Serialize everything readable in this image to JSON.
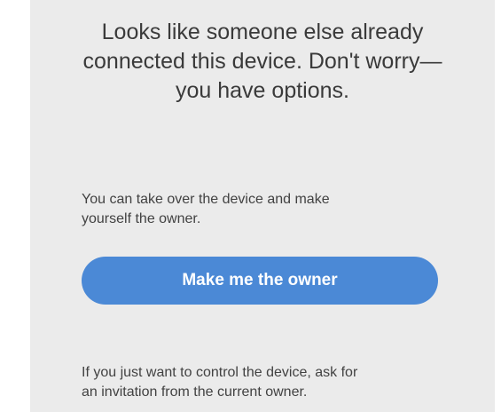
{
  "header": {
    "line_1": "Looks like someone else already",
    "line_2": "connected this device. Don't worry—",
    "line_3": "you have options."
  },
  "takeover": {
    "line_1": "You can take over the device and make",
    "line_2": "yourself the owner.",
    "button_label": "Make me the owner"
  },
  "invite": {
    "line_1": "If you just want to control the device, ask for",
    "line_2": "an invitation from the current owner."
  },
  "colors": {
    "background": "#ebebeb",
    "button": "#4b89d6",
    "text": "#3a3a3a"
  }
}
